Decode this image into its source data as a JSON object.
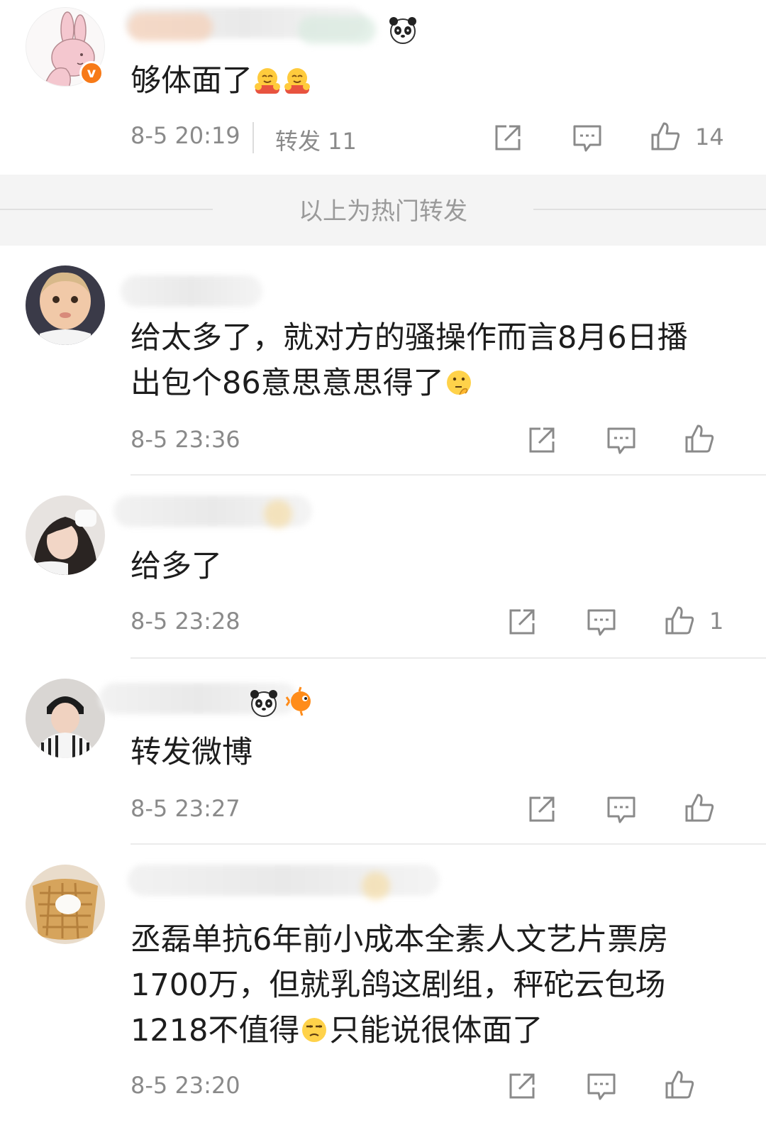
{
  "posts": [
    {
      "content": "够体面了",
      "content_emojis": [
        "hug-emoji",
        "hug-emoji"
      ],
      "time": "8-5 20:19",
      "forward": "转发 11",
      "likes": "14"
    },
    {
      "content": "给太多了，就对方的骚操作而言8月6日播出包个86意思意思得了",
      "content_emojis": [
        "thinking-emoji"
      ],
      "time": "8-5 23:36",
      "likes": ""
    },
    {
      "content": "给多了",
      "time": "8-5 23:28",
      "likes": "1"
    },
    {
      "content": "转发微博",
      "time": "8-5 23:27",
      "likes": ""
    },
    {
      "content": "丞磊单抗6年前小成本全素人文艺片票房1700万，但就乳鸽这剧组，秤砣云包场1218不值得",
      "content_tail": "只能说很体面了",
      "content_emojis": [
        "eye-roll-emoji"
      ],
      "time": "8-5 23:20",
      "likes": ""
    }
  ],
  "hot_divider": {
    "label": "以上为热门转发"
  },
  "colors": {
    "accent_orange": "#f77a18",
    "text_gray": "#8a8a8a",
    "divider": "#ebebeb"
  }
}
